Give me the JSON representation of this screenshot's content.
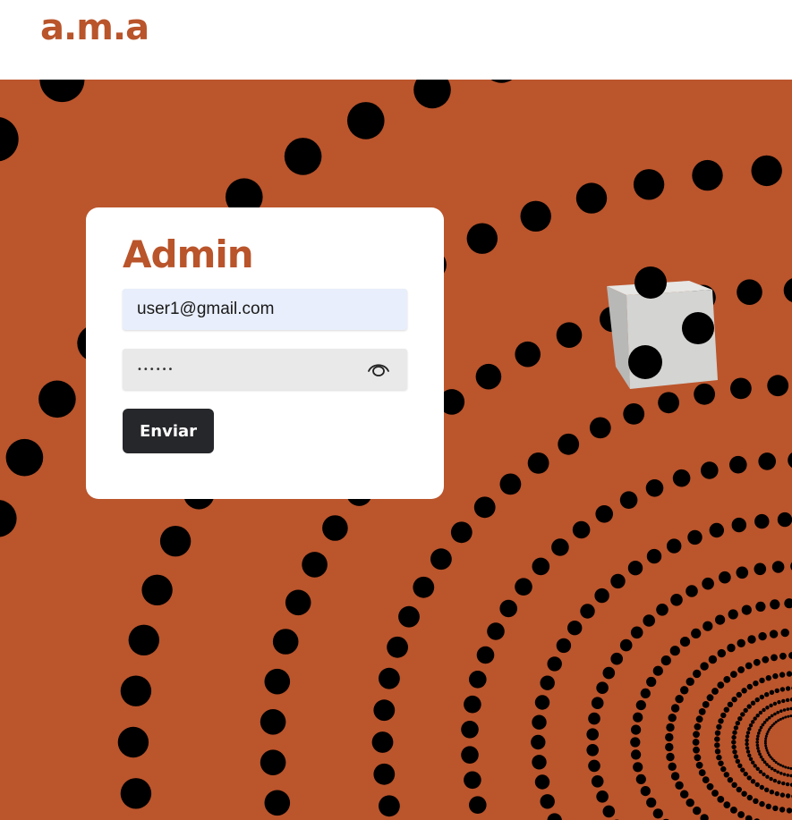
{
  "header": {
    "logo": "a.m.a"
  },
  "login": {
    "title": "Admin",
    "email_value": "user1@gmail.com",
    "password_value": "••••••",
    "show_password_icon": "eye-icon",
    "submit_label": "Enviar"
  },
  "background": {
    "pattern": "polka-dot tunnel",
    "decoration": "die-showing-three"
  },
  "colors": {
    "brand": "#b9542b",
    "background": "#bb552c",
    "dots": "#000000",
    "card": "#ffffff",
    "email_field": "#e8eefb",
    "password_field": "#e9e9e9",
    "button": "#26272b",
    "button_text": "#ffffff",
    "die_face": "#d4d4d2"
  }
}
